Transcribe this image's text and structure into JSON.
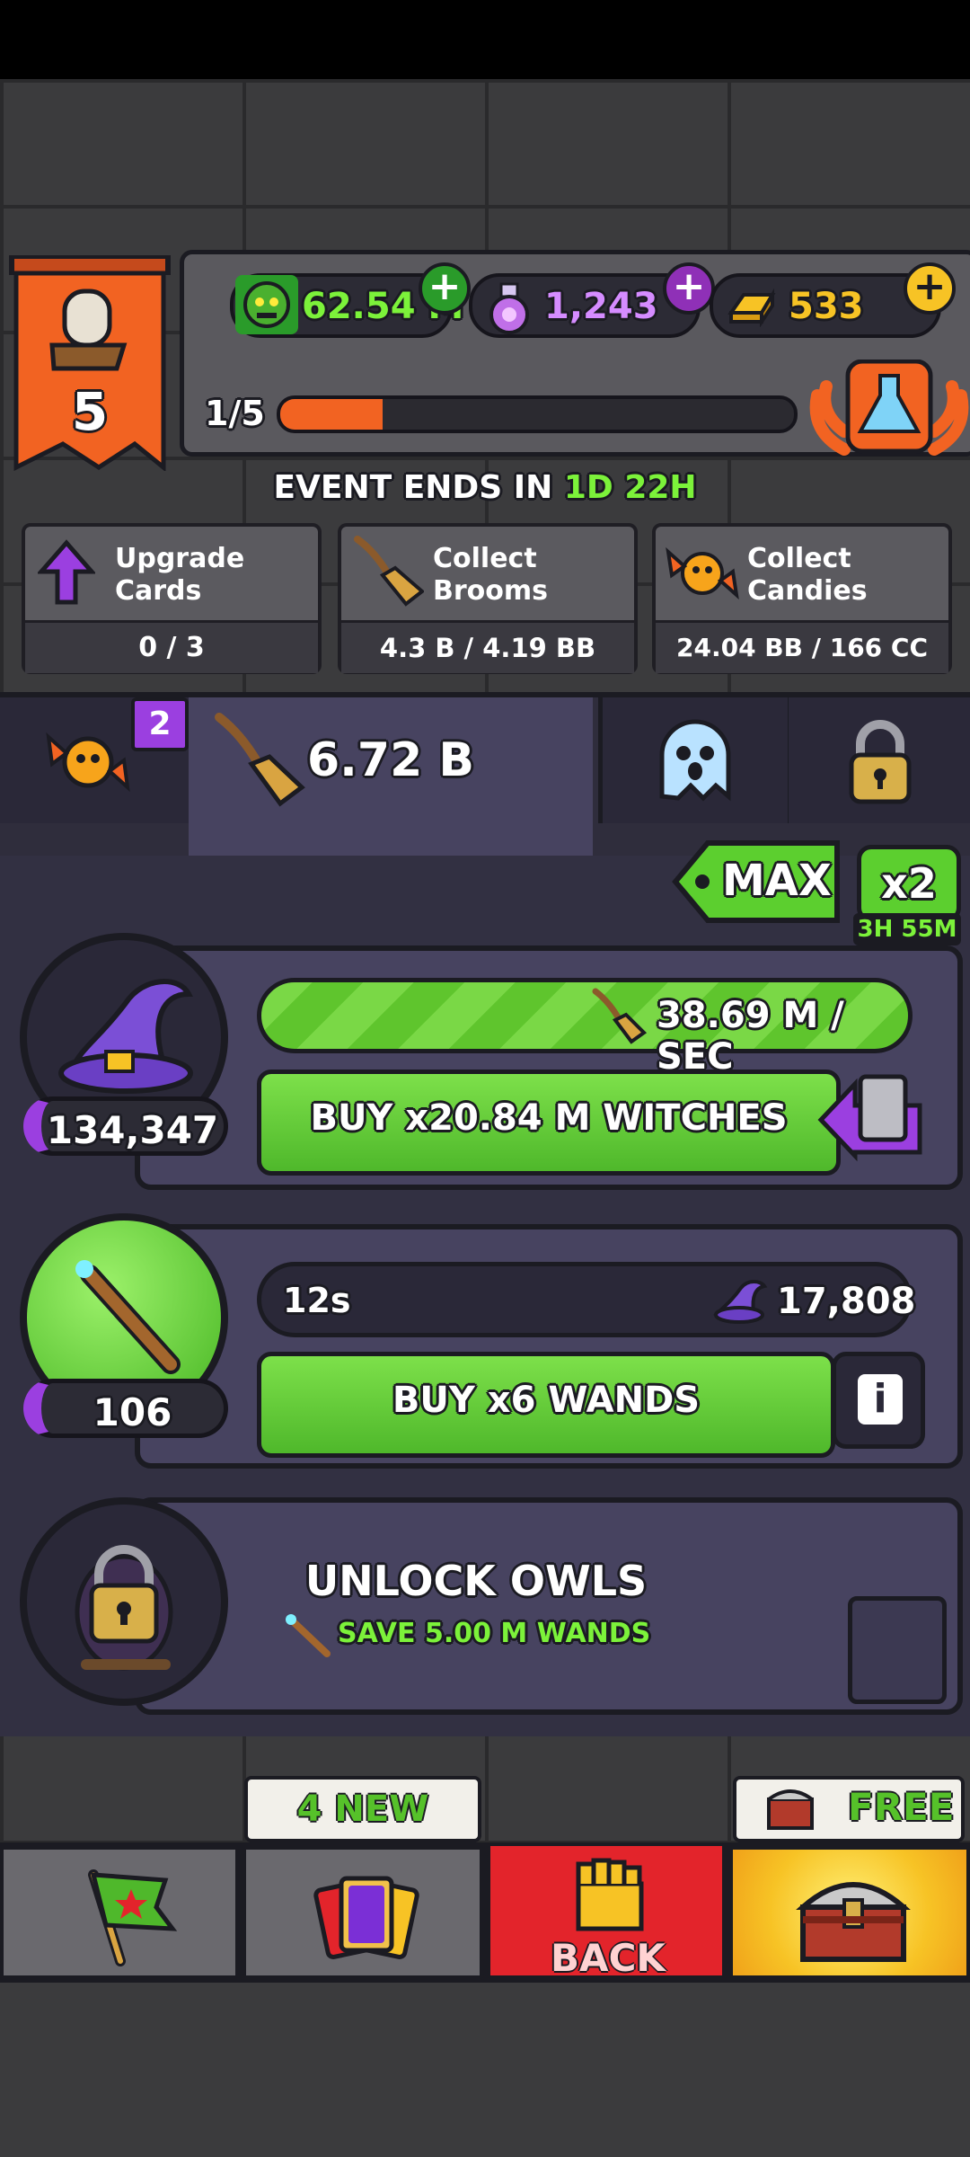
{
  "header": {
    "level": "5",
    "currencies": [
      {
        "name": "zombie-currency",
        "value": "62.54 M"
      },
      {
        "name": "potion-currency",
        "value": "1,243"
      },
      {
        "name": "gold-currency",
        "value": "533"
      }
    ],
    "progress_label": "1/5",
    "progress_fraction": 0.2
  },
  "event": {
    "title_prefix": "EVENT ENDS IN ",
    "time_days": "1D",
    "time_hours": "22H",
    "tasks": [
      {
        "label_line1": "Upgrade",
        "label_line2": "Cards",
        "progress": "0 / 3"
      },
      {
        "label_line1": "Collect",
        "label_line2": "Brooms",
        "progress": "4.3 B / 4.19 BB"
      },
      {
        "label_line1": "Collect",
        "label_line2": "Candies",
        "progress": "24.04 BB / 166 CC"
      }
    ]
  },
  "tabs": {
    "candy_badge": "2",
    "brooms_value": "6.72 B"
  },
  "multiplier": {
    "max_label": "MAX",
    "boost_label": "x2",
    "boost_timer": "3H 55M"
  },
  "witches": {
    "count": "134,347",
    "rate": "38.69 M / SEC",
    "buy_label": "BUY x20.84 M WITCHES"
  },
  "wands": {
    "count": "106",
    "timer": "12s",
    "cost": "17,808",
    "buy_label": "BUY x6 WANDS",
    "info": "i"
  },
  "owls": {
    "title": "UNLOCK OWLS",
    "requirement": "SAVE 5.00 M WANDS"
  },
  "bottom_nav": {
    "cards_badge": "4 NEW",
    "back_label": "BACK",
    "chest_badge": "FREE"
  },
  "colors": {
    "accent_green": "#7cf23a",
    "orange": "#f26322",
    "purple": "#8f30b7",
    "red_back": "#e3242b",
    "gold": "#f7c325"
  }
}
